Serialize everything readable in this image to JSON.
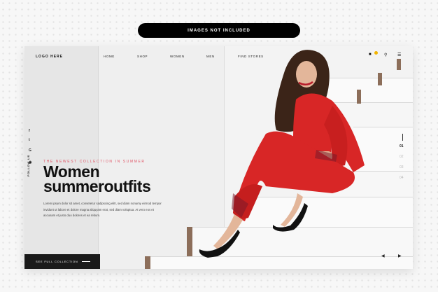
{
  "notice": "IMAGES NOT INCLUDED",
  "logo": "LOGO HERE",
  "nav": [
    "HOME",
    "SHOP",
    "WOMEN",
    "MEN",
    "FIND STORES"
  ],
  "follow": "FOLLOW US",
  "kicker": "THE NEWEST COLLECTION IN SUMMER",
  "headline_line1": "Women",
  "headline_line2": "summeroutfits",
  "paragraph": "Lorem ipsum dolor sit amet, consetetur sadipscing elitr, sed diam nonumy eirmod tempor invidunt ut labore et dolore magna aliquyam erat, sed diam voluptua. At vero eos et accusam et justo duo dolores et ea rebum.",
  "cta": "SEE FULL COLLECTION",
  "pages": [
    "01",
    "02",
    "03",
    "04"
  ],
  "icons": {
    "cart": "bag-icon",
    "search": "search-icon",
    "menu": "hamburger-menu-icon",
    "prev": "prev-arrow-icon",
    "next": "next-arrow-icon"
  },
  "colors": {
    "accent_red": "#e03030",
    "kicker_pink": "#e05566",
    "badge_yellow": "#f2b400",
    "dark": "#1a1a1a"
  }
}
